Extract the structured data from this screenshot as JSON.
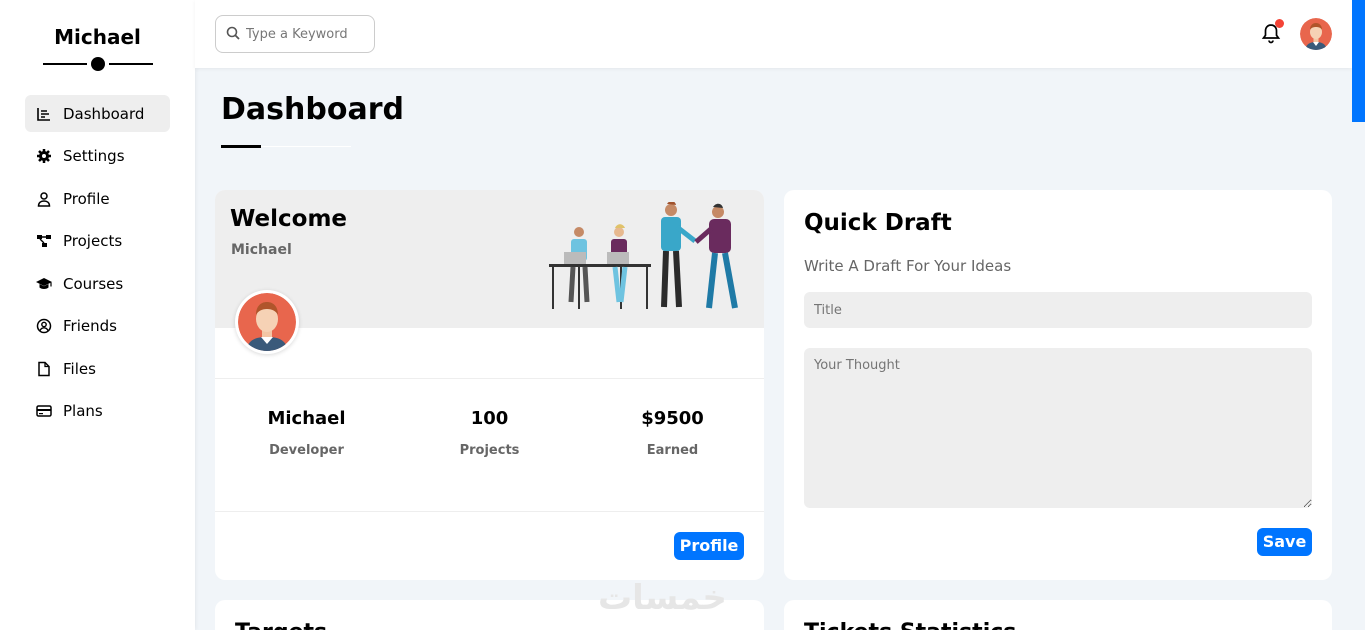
{
  "sidebar": {
    "brand": "Michael",
    "items": [
      {
        "label": "Dashboard",
        "icon": "chart-icon",
        "active": true
      },
      {
        "label": "Settings",
        "icon": "gear-icon"
      },
      {
        "label": "Profile",
        "icon": "user-icon"
      },
      {
        "label": "Projects",
        "icon": "diagram-icon"
      },
      {
        "label": "Courses",
        "icon": "graduation-cap-icon"
      },
      {
        "label": "Friends",
        "icon": "user-circle-icon"
      },
      {
        "label": "Files",
        "icon": "file-icon"
      },
      {
        "label": "Plans",
        "icon": "credit-card-icon"
      }
    ]
  },
  "header": {
    "search_placeholder": "Type a Keyword",
    "notification": true
  },
  "page": {
    "title": "Dashboard"
  },
  "welcome": {
    "title": "Welcome",
    "name": "Michael",
    "stats": [
      {
        "value": "Michael",
        "label": "Developer"
      },
      {
        "value": "100",
        "label": "Projects"
      },
      {
        "value": "$9500",
        "label": "Earned"
      }
    ],
    "button": "Profile"
  },
  "draft": {
    "title": "Quick Draft",
    "subtitle": "Write A Draft For Your Ideas",
    "title_placeholder": "Title",
    "thought_placeholder": "Your Thought",
    "button": "Save"
  },
  "bottom": {
    "targets_title": "Targets",
    "tickets_title": "Tickets Statistics"
  },
  "watermark": "خمسات",
  "colors": {
    "accent": "#0075ff",
    "background": "#f1f5f9",
    "notification": "#f44336"
  }
}
